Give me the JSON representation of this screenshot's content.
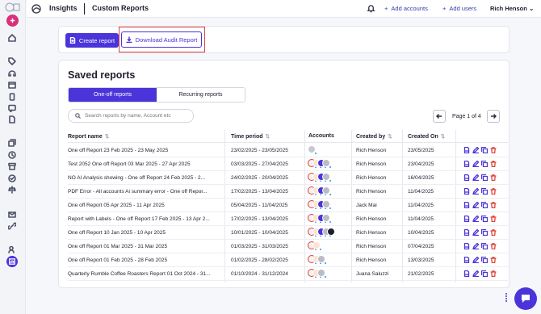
{
  "app": {
    "brand": "Insights",
    "page_title": "Custom Reports"
  },
  "topbar": {
    "add_accounts": "Add accounts",
    "add_users": "Add users",
    "user_name": "Rich Henson"
  },
  "actions_bar": {
    "create_report": "Create report",
    "download_audit": "Download Audit Report"
  },
  "saved": {
    "title": "Saved reports",
    "tabs": [
      {
        "label": "One-off reports",
        "active": true
      },
      {
        "label": "Recurring reports",
        "active": false
      }
    ],
    "search_placeholder": "Search reports by name, Account etc",
    "pagination": "Page 1 of 4",
    "columns": {
      "name": "Report name",
      "period": "Time period",
      "accounts": "Accounts",
      "created_by": "Created by",
      "created_on": "Created On"
    },
    "rows": [
      {
        "name": "One off Report 23 Feb 2025 - 23 May 2025",
        "period": "23/02/2025 - 23/05/2025",
        "by": "Rich Henson",
        "on": "23/05/2025",
        "acc": "grey"
      },
      {
        "name": "Test 2052 One off Report 03 Mar 2025 - 27 Apr 2025",
        "period": "03/03/2025 - 27/04/2025",
        "by": "Rich Henson",
        "on": "23/04/2025",
        "acc": "full"
      },
      {
        "name": "NO AI Analysis showing - One off Report 24 Feb 2025 - 2...",
        "period": "24/02/2025 - 20/04/2025",
        "by": "Rich Henson",
        "on": "16/04/2025",
        "acc": "full"
      },
      {
        "name": "PDF Error - All accounts Ai summary error - One off Repor...",
        "period": "17/02/2025 - 13/04/2025",
        "by": "Rich Henson",
        "on": "11/04/2025",
        "acc": "full"
      },
      {
        "name": "One off Report 05 Apr 2025 - 11 Apr 2025",
        "period": "05/04/2025 - 11/04/2025",
        "by": "Jack Mai",
        "on": "11/04/2025",
        "acc": "full"
      },
      {
        "name": "Report with Labels - One off Report 17 Feb 2025 - 13 Apr 2...",
        "period": "17/02/2025 - 13/04/2025",
        "by": "Rich Henson",
        "on": "11/04/2025",
        "acc": "full"
      },
      {
        "name": "One off Report 10 Jan 2025 - 10 Apr 2025",
        "period": "10/01/2025 - 10/04/2025",
        "by": "Rich Henson",
        "on": "10/04/2025",
        "acc": "fullplus"
      },
      {
        "name": "One off Report 01 Mar 2025 - 31 Mar 2025",
        "period": "01/03/2025 - 31/03/2025",
        "by": "Rich Henson",
        "on": "07/04/2025",
        "acc": "two"
      },
      {
        "name": "One off Report 01 Feb 2025 - 28 Feb 2025",
        "period": "01/02/2025 - 28/02/2025",
        "by": "Rich Henson",
        "on": "13/03/2025",
        "acc": "three"
      },
      {
        "name": "Quarterly Rumble Coffee Roasters Report 01 Oct 2024 - 31...",
        "period": "01/10/2024 - 31/12/2024",
        "by": "Juana Saluzzi",
        "on": "21/02/2025",
        "acc": "three"
      }
    ]
  },
  "colors": {
    "accent": "#4b34d9",
    "highlight": "#e0403a",
    "pink": "#d8307a"
  }
}
